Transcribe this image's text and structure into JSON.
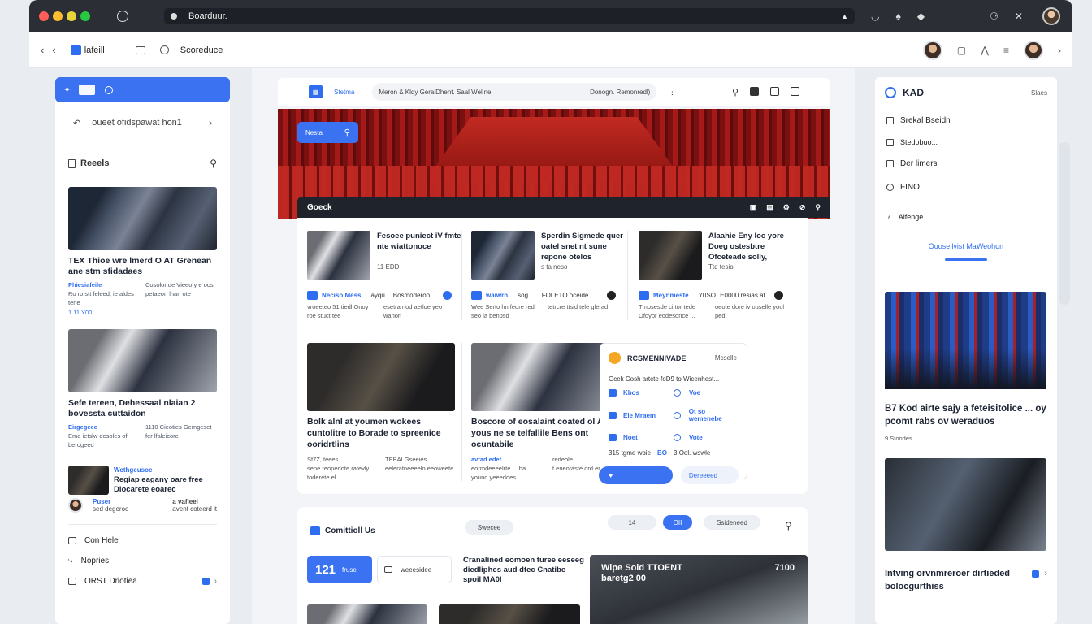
{
  "browser": {
    "url": "Boarduur."
  },
  "appbar": {
    "brand": "lafeill",
    "schedule": "Scoreduce"
  },
  "left": {
    "crumb": "oueet ofidspawat hon1",
    "section": "Reeels",
    "story1": {
      "title": "TEX Thioe wre lmerd O AT Grenean ane stm sfidadaes",
      "tag": "Phiesiafeile",
      "meta_left": "Ro ro stt feleed, ie aldes tene",
      "meta_right": "Cosolor de Vieeo y e oos petaeon lhan ote",
      "count": "1 11 Y00"
    },
    "story2": {
      "title": "Sefe tereen, Dehessaal nlaian 2 bovessta cuttaidon",
      "tag": "Eirgegeee",
      "meta_left": "Eme ietslw desoles of berogeed",
      "meta_right": "1110 Cieoties Gemgeset fer lfaleicore",
      "count": ""
    },
    "story3": {
      "tag": "Wethgeusoe",
      "title": "Regiap eagany oare free Diocarete eoarec",
      "sub_left": "Puser",
      "sub_left2": "sed degeroo",
      "sub_right": "a vafieel",
      "sub_right2": "avent coteerd it"
    },
    "links": [
      {
        "label": "Con Hele"
      },
      {
        "label": "Nopries"
      },
      {
        "label": "ORST Driotiea"
      }
    ]
  },
  "center": {
    "search_label": "Stetma",
    "search_text": "Meron & Kldy GeraiDhent. Saal Weline",
    "search_right": "Donogn. Remonredl)",
    "hero_btn": "Nesta",
    "subbar_title": "Goeck",
    "news": [
      {
        "title": "Fesoee puniect iV fmte nte wiattonoce",
        "sub": "11 EDD",
        "tag": "Neciso Mess",
        "tag_b": "ayqu",
        "right": "Bosmoderoo",
        "meta_left": "vroeeteo 51 tiedl Onoy roe stuct tee",
        "meta_right": "esetra nod aetloe yeo wanorl"
      },
      {
        "title": "Sperdin Sigmede quer oatel snet nt sune repone otelos",
        "sub": "s ta neso",
        "tag": "waiwrn",
        "tag_b": "sog",
        "right": "FOLETO oceide",
        "meta_left": "Wee Serto hn feore redl seo la benpsd",
        "meta_right": "tetrcre ttsid tele glerad"
      },
      {
        "title": "Alaahie Eny loe yore Doeg ostesbtre Ofceteade solly,",
        "sub": "Ttd tesio",
        "tag": "Meynmeste",
        "tag_b": "Y0SO",
        "right": "E0000 resias at",
        "meta_left": "Tmosesde ci tor tede Ofoyor eodesonce ...",
        "meta_right": "oeote dore iv ouselle youl ped"
      }
    ],
    "big": [
      {
        "title": "Bolk alnl at youmen wokees cuntolitre to Borade to spreenice ooridrtlins",
        "tag": "Sf7Z, teees",
        "meta_left": "sepe reopedote ratevly toderete el ...",
        "meta_right": "TEBAI Gseeies eeleratneeeelo eeoweete"
      },
      {
        "title": "Boscore of eosalaint coated ol Avle yous ne se telfallile Bens ont ocuntabile",
        "tag": "avtad edet",
        "tag_b": "redeole",
        "meta_left": "eormdeeeelrte ... ba yound yeeedoes ...",
        "meta_right": "t eneotaste ord ented"
      }
    ],
    "panel": {
      "title": "RCSMENNIVADE",
      "more": "Mcselle",
      "line": "Gcek Cosh artcte foD9 to Wicenhest...",
      "grid": [
        "Kbos",
        "Voe",
        "Ele Mraem",
        "Ot so wemenebe",
        "Noet",
        "Vote"
      ],
      "bot_a": "315 tgme wbie",
      "bot_b": "BO",
      "bot_c": "3 Ool. wswle",
      "btn2": "Dereeeed"
    },
    "lower": {
      "title": "Comittioll Us",
      "pill1": "Swecee",
      "pill2": "14",
      "pill3": "OII",
      "pill4": "Ssideneed",
      "num": "121",
      "num_sub": "fruse",
      "box": "weeesidee",
      "text": "Cranalined eomoen turee eeseeg diedliphes aud dtec Cnatibe spoil MA0I",
      "img_title": "Wipe Sold TTOENT baretg2 00",
      "img_num": "7100"
    }
  },
  "right": {
    "head": "KAD",
    "head_right": "Slaes",
    "items": [
      {
        "label": "Srekal Bseidn"
      },
      {
        "label": "Stedobuo..."
      },
      {
        "label": "Der limers"
      },
      {
        "label": "FINO"
      },
      {
        "label": "Alfenge"
      }
    ],
    "center_link": "Ouosellvist MaWeohon",
    "story": "B7 Kod airte sajy a feteisitolice ... oy pcomt rabs ov weraduos",
    "story_small": "9 Stoodes",
    "footer": "Intving orvnmreroer dirtieded bolocgurthiss"
  }
}
